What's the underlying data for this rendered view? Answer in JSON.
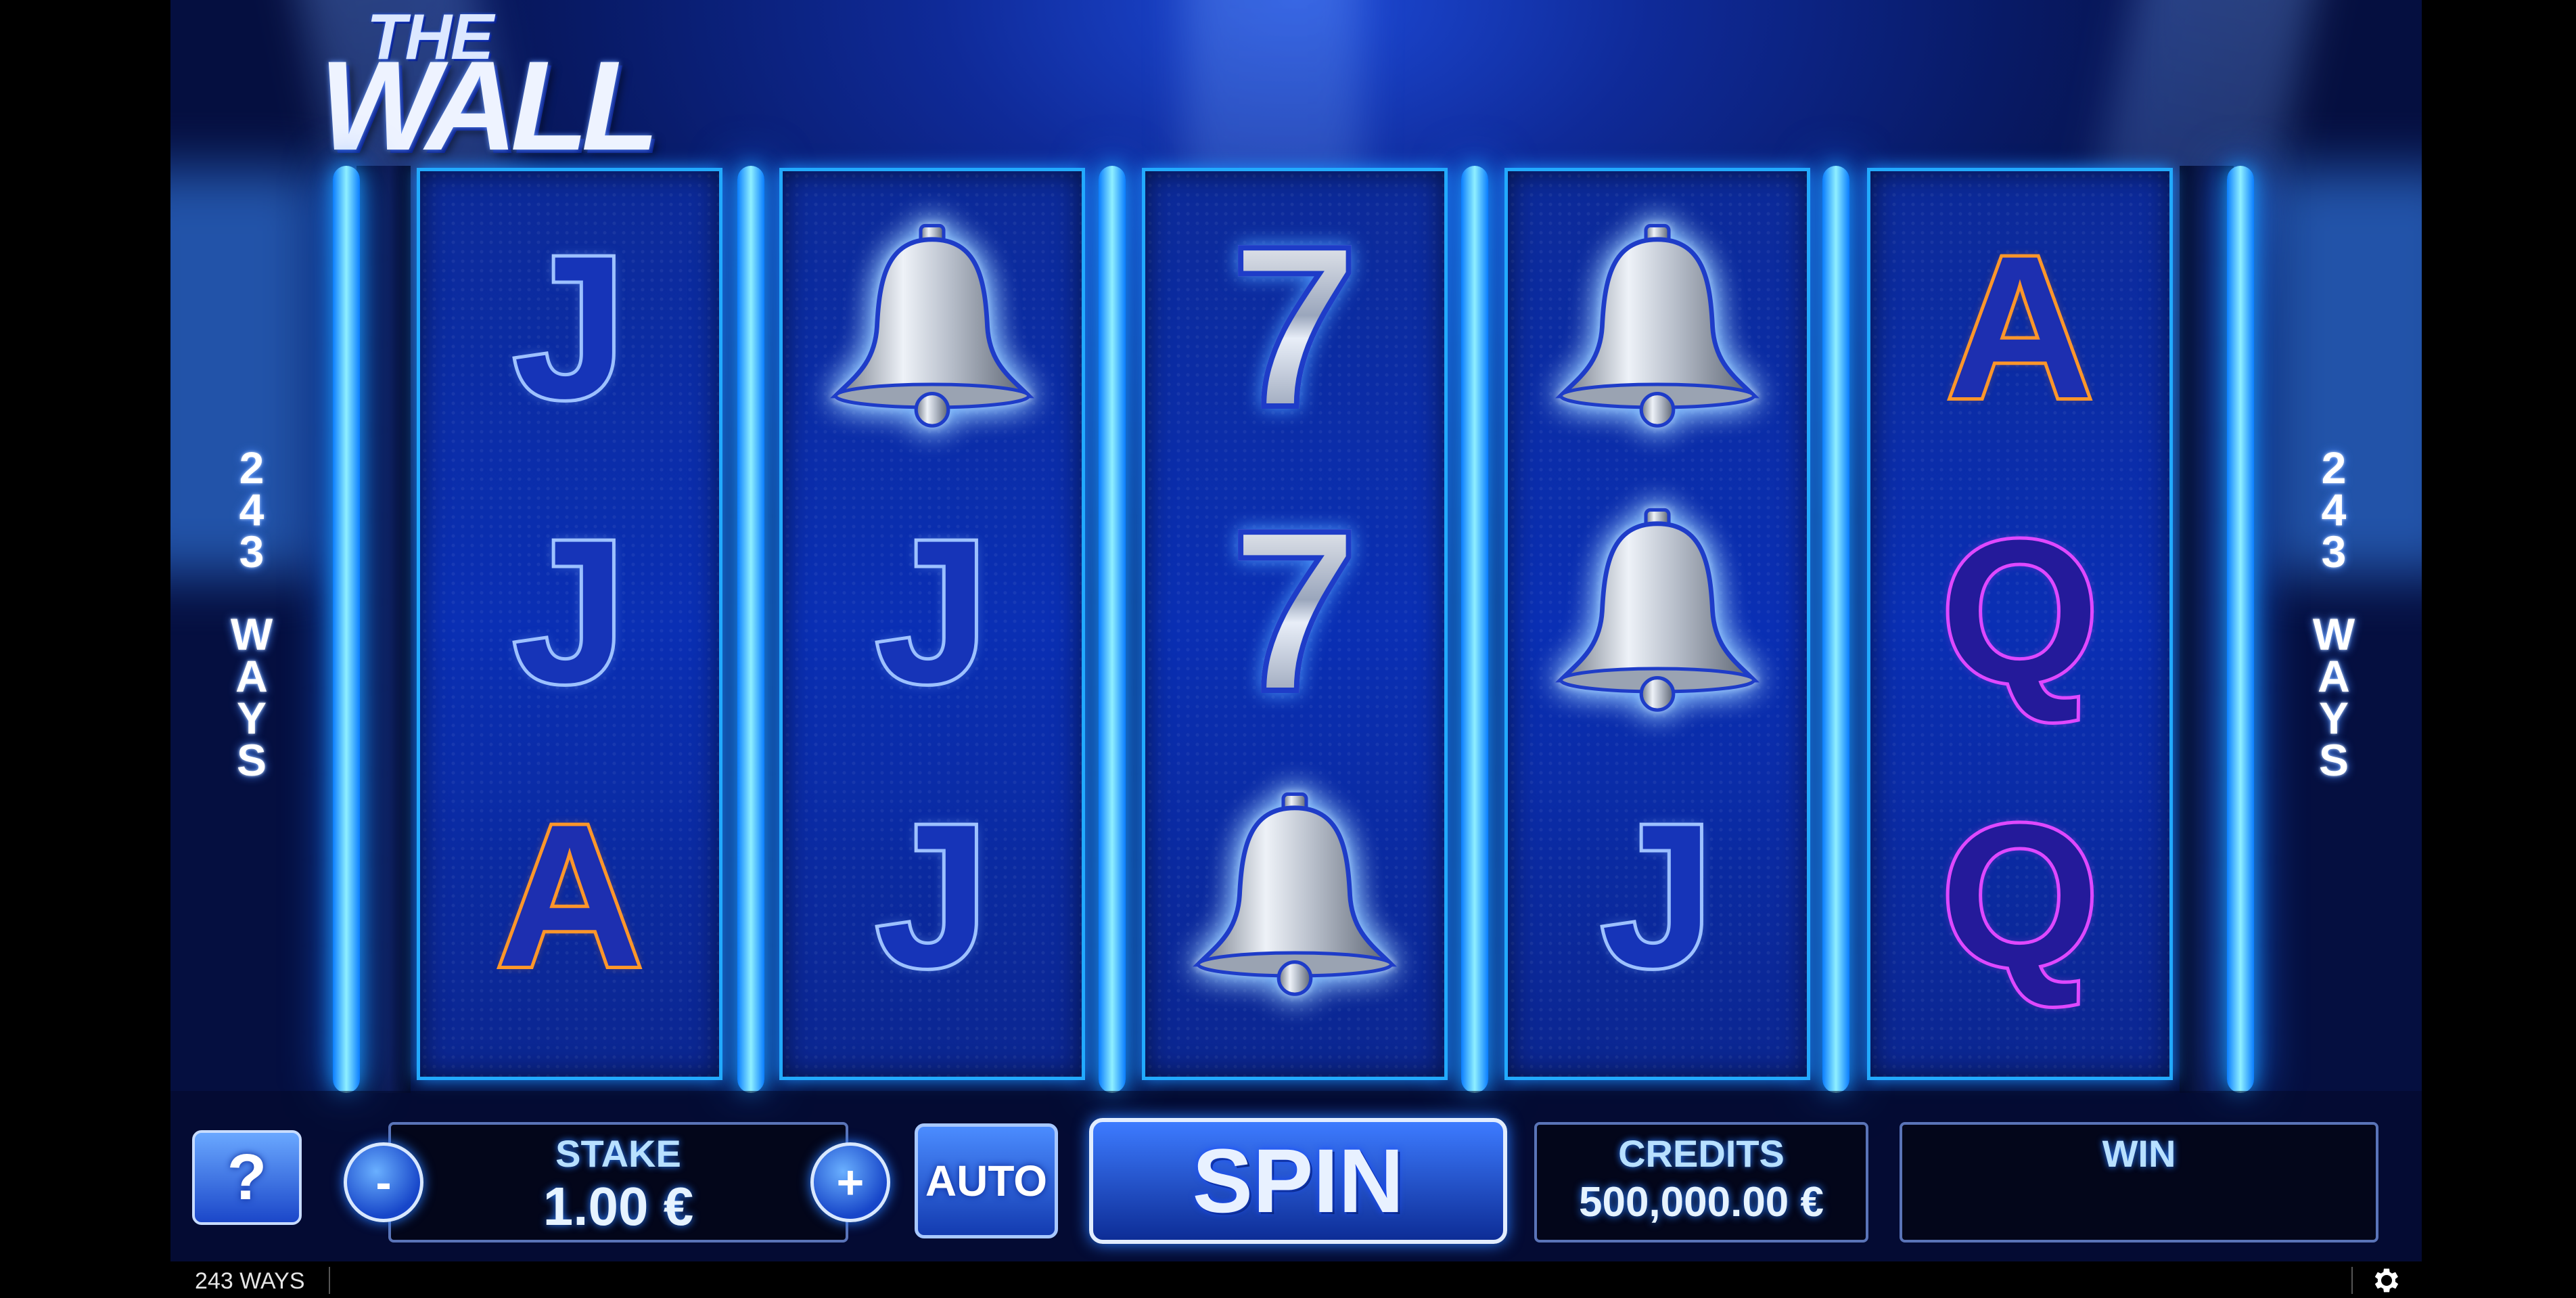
{
  "logo": {
    "line1": "THE",
    "line2": "WALL"
  },
  "ways_banner": {
    "number": [
      "2",
      "4",
      "3"
    ],
    "word": [
      "W",
      "A",
      "Y",
      "S"
    ]
  },
  "reels": [
    {
      "symbols": [
        {
          "type": "letter",
          "value": "J"
        },
        {
          "type": "letter",
          "value": "J"
        },
        {
          "type": "letter",
          "value": "A"
        }
      ]
    },
    {
      "symbols": [
        {
          "type": "bell",
          "value": ""
        },
        {
          "type": "letter",
          "value": "J"
        },
        {
          "type": "letter",
          "value": "J"
        }
      ]
    },
    {
      "symbols": [
        {
          "type": "seven",
          "value": "7"
        },
        {
          "type": "seven",
          "value": "7"
        },
        {
          "type": "bell",
          "value": ""
        }
      ]
    },
    {
      "symbols": [
        {
          "type": "bell",
          "value": ""
        },
        {
          "type": "bell",
          "value": ""
        },
        {
          "type": "letter",
          "value": "J"
        }
      ]
    },
    {
      "symbols": [
        {
          "type": "letter",
          "value": "A"
        },
        {
          "type": "letter",
          "value": "Q"
        },
        {
          "type": "letter",
          "value": "Q"
        }
      ]
    }
  ],
  "controls": {
    "help_label": "?",
    "minus_label": "-",
    "plus_label": "+",
    "stake_label": "STAKE",
    "stake_value": "1.00 €",
    "auto_label": "AUTO",
    "spin_label": "SPIN",
    "credits_label": "CREDITS",
    "credits_value": "500,000.00 €",
    "win_label": "WIN",
    "win_value": ""
  },
  "footer": {
    "ways_text": "243 WAYS",
    "settings_icon": "gear-icon"
  },
  "colors": {
    "reel_border": "#22aaff",
    "accent_orange": "#ff9a2c",
    "accent_magenta": "#e04aff",
    "background_blue": "#0f2a98"
  }
}
